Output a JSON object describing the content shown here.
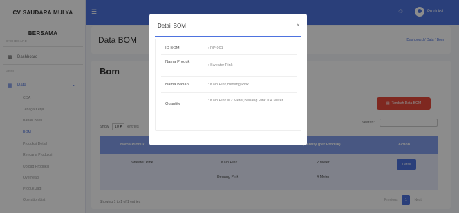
{
  "sidebar": {
    "brand_line1": "CV SAUDARA MULYA",
    "brand_line2": "BERSAMA",
    "heading_dashboard": "DASHBOARD",
    "dashboard_label": "Dashboard",
    "heading_menu": "MENU",
    "data_label": "Data",
    "sub_items": [
      "COA",
      "Tenaga Kerja",
      "Bahan Baku",
      "BOM",
      "Produksi Detail",
      "Rencana Produksi",
      "Upload Produksi",
      "Overhead",
      "Produk Jadi",
      "Operation List"
    ]
  },
  "topbar": {
    "user_name": "Produksi"
  },
  "page_header": {
    "title": "Data BOM",
    "breadcrumb": "Dashboard / Data / Bom"
  },
  "content": {
    "title": "Bom",
    "add_button": "Tambah Data BOM",
    "show_label": "Show",
    "show_value": "10",
    "entries_label": "entries",
    "search_label": "Search:",
    "columns": [
      "Nama Produk",
      "Nama Bahan",
      "Quantity (per Produk)",
      "Action"
    ],
    "row": {
      "produk": "Sweater Pink",
      "bahan": [
        "Kain Pink",
        "Benang Pink"
      ],
      "quantity": [
        "2 Meter",
        "4 Meter"
      ],
      "action": "Detail"
    },
    "info": "Showing 1 to 1 of 1 entries",
    "pagination": {
      "previous": "Previous",
      "current": "1",
      "next": "Next"
    }
  },
  "modal": {
    "title": "Detail BOM",
    "close": "×",
    "rows": [
      {
        "label": "ID BOM",
        "value": ": RP-001"
      },
      {
        "label": "Nama Produk",
        "value": ": Sweater Pink"
      },
      {
        "label": "Nama Bahan",
        "value": ": Kain Pink,Benang Pink"
      },
      {
        "label": "Quantity",
        "value": ": Kain Pink = 2 Meter,Benang Pink = 4 Meter"
      }
    ]
  },
  "colors": {
    "primary": "#4e73df",
    "danger": "#e74a3b"
  },
  "icons": [
    "menu-icon",
    "dashboard-icon",
    "table-icon",
    "chevron-down-icon",
    "bell-icon",
    "user-icon",
    "close-icon"
  ]
}
